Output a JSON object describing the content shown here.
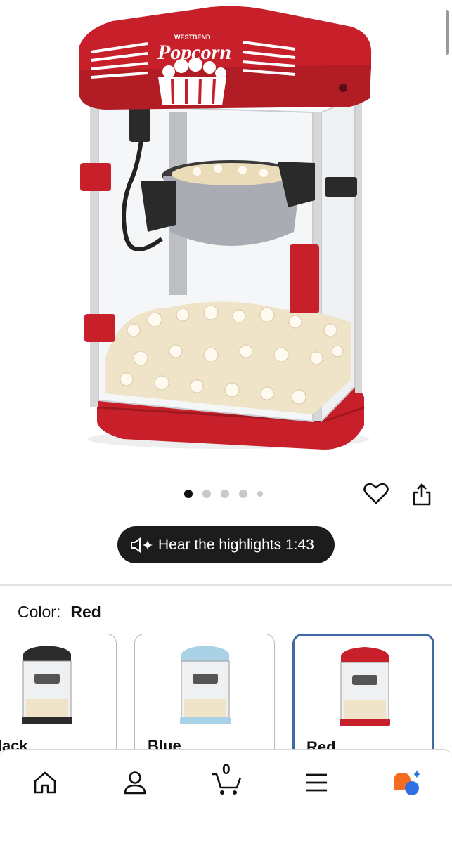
{
  "product_image": {
    "brand_text": "WESTBEND",
    "logo_text": "Popcorn"
  },
  "carousel": {
    "total": 5,
    "active_index": 0
  },
  "actions": {
    "favorite_icon": "heart-icon",
    "share_icon": "share-icon"
  },
  "audio": {
    "label": "Hear the highlights 1:43",
    "icon": "speaker-sparkle-icon"
  },
  "color": {
    "label": "Color:",
    "selected": "Red",
    "options": [
      {
        "label": "Black",
        "body": "#2b2b2b"
      },
      {
        "label": "Blue",
        "body": "#a9d2e6"
      },
      {
        "label": "Red",
        "body": "#c8202a"
      }
    ]
  },
  "tabbar": {
    "cart_count": "0",
    "items": [
      "home-icon",
      "account-icon",
      "cart-icon",
      "menu-icon",
      "assistant-icon"
    ]
  },
  "colors": {
    "accent_red": "#c8202a",
    "selected_border": "#3d6aa5",
    "pill_bg": "#1c1c1c"
  }
}
